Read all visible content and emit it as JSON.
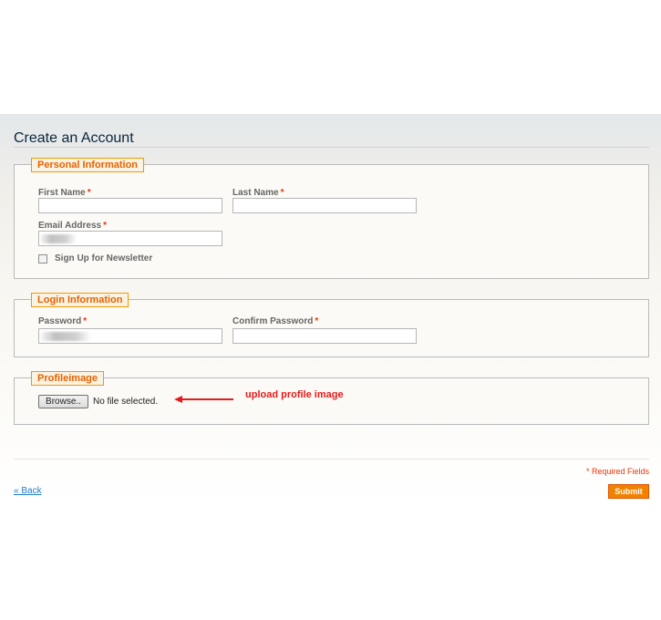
{
  "page": {
    "title": "Create an Account"
  },
  "personal": {
    "legend": "Personal Information",
    "first_name_label": "First Name",
    "last_name_label": "Last Name",
    "email_label": "Email Address",
    "newsletter_label": "Sign Up for Newsletter",
    "required_mark": "*"
  },
  "login": {
    "legend": "Login Information",
    "password_label": "Password",
    "confirm_label": "Confirm Password",
    "required_mark": "*"
  },
  "profile": {
    "legend": "Profileimage",
    "browse_label": "Browse..",
    "file_status": "No file selected.",
    "annotation": "upload profile image"
  },
  "footer": {
    "required_note": "* Required Fields",
    "back_label": "« Back",
    "submit_label": "Submit"
  },
  "colors": {
    "accent_orange": "#f18200",
    "legend_text": "#e76200",
    "required_red": "#eb340a",
    "link_blue": "#1e7ec8",
    "annotation_red": "#e41b1b"
  }
}
